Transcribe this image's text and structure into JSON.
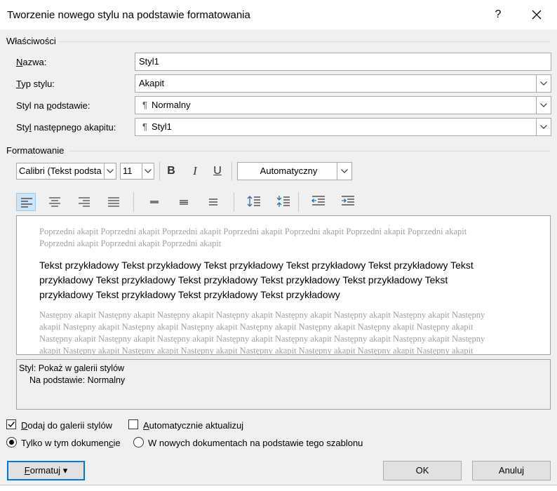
{
  "dialog": {
    "title": "Tworzenie nowego stylu na podstawie formatowania",
    "help": "?"
  },
  "properties": {
    "group_label": "Właściwości",
    "name_label_u": "N",
    "name_label_rest": "azwa:",
    "name_value": "Styl1",
    "type_label_u": "T",
    "type_label_rest": "yp stylu:",
    "type_value": "Akapit",
    "based_label_a": "Styl na ",
    "based_label_u": "p",
    "based_label_b": "odstawie:",
    "based_value": "Normalny",
    "next_label_a": "Sty",
    "next_label_u": "l",
    "next_label_b": " następnego akapitu:",
    "next_value": "Styl1",
    "para_mark": "¶"
  },
  "formatting": {
    "group_label": "Formatowanie",
    "font": "Calibri (Tekst podsta",
    "size": "11",
    "bold": "B",
    "italic": "I",
    "underline": "U",
    "color": "Automatyczny"
  },
  "preview": {
    "previous": "Poprzedni akapit Poprzedni akapit Poprzedni akapit Poprzedni akapit Poprzedni akapit Poprzedni akapit Poprzedni akapit Poprzedni akapit Poprzedni akapit Poprzedni akapit",
    "sample": "Tekst przykładowy Tekst przykładowy Tekst przykładowy Tekst przykładowy Tekst przykładowy Tekst przykładowy Tekst przykładowy Tekst przykładowy Tekst przykładowy Tekst przykładowy Tekst przykładowy Tekst przykładowy Tekst przykładowy Tekst przykładowy",
    "next": "Następny akapit Następny akapit Następny akapit Następny akapit Następny akapit Następny akapit Następny akapit Następny akapit Następny akapit Następny akapit Następny akapit Następny akapit Następny akapit Następny akapit Następny akapit Następny akapit Następny akapit Następny akapit Następny akapit Następny akapit Następny akapit Następny akapit Następny akapit Następny akapit Następny akapit Następny akapit Następny akapit Następny akapit Następny akapit Następny akapit Następny akapit Następny akapit Następny akapit Następny akapit Następny akapit Następny akapit"
  },
  "description": {
    "line1": "Styl: Pokaż w galerii stylów",
    "line2": "Na podstawie: Normalny"
  },
  "options": {
    "add_gallery_u": "D",
    "add_gallery_rest": "odaj do galerii stylów",
    "add_gallery_checked": true,
    "auto_update_u": "A",
    "auto_update_rest": "utomatycznie aktualizuj",
    "auto_update_checked": false,
    "only_doc_a": "Tylko w tym dokumen",
    "only_doc_u": "c",
    "only_doc_b": "ie",
    "new_docs": "W nowych dokumentach na podstawie tego szablonu"
  },
  "buttons": {
    "format_u": "F",
    "format_rest": "ormatuj",
    "format_arrow": "▾",
    "ok": "OK",
    "cancel": "Anuluj"
  },
  "colors": {
    "accent": "#0078d7",
    "active_align_bg": "#cce4f7"
  }
}
